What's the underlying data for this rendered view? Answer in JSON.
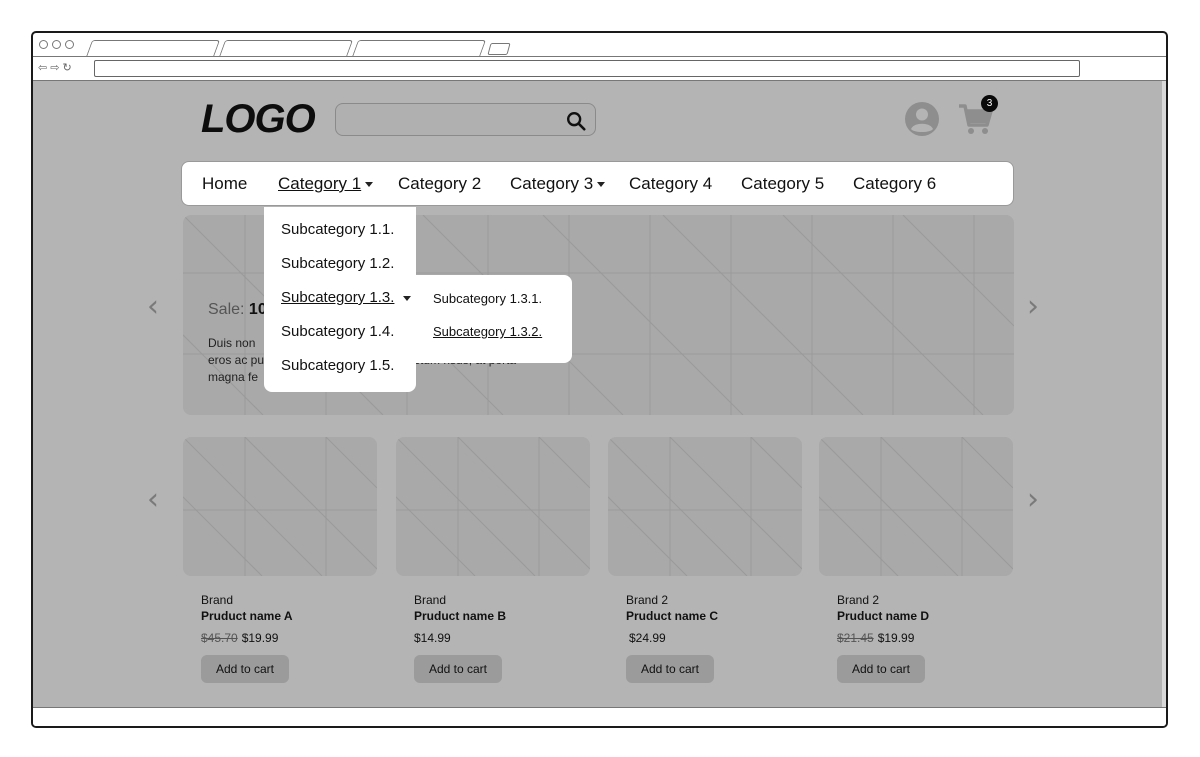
{
  "header": {
    "logo": "LOGO",
    "search_placeholder": "",
    "cart_count": "3"
  },
  "nav": {
    "items": [
      {
        "label": "Home",
        "has_caret": false,
        "active": false
      },
      {
        "label": "Category 1",
        "has_caret": true,
        "active": true
      },
      {
        "label": "Category 2",
        "has_caret": false,
        "active": false
      },
      {
        "label": "Category 3",
        "has_caret": true,
        "active": false
      },
      {
        "label": "Category 4",
        "has_caret": false,
        "active": false
      },
      {
        "label": "Category 5",
        "has_caret": false,
        "active": false
      },
      {
        "label": "Category 6",
        "has_caret": false,
        "active": false
      }
    ]
  },
  "dropdown": {
    "items": [
      {
        "label": "Subcategory 1.1."
      },
      {
        "label": "Subcategory 1.2."
      },
      {
        "label": "Subcategory 1.3.",
        "active": true,
        "has_caret": true
      },
      {
        "label": "Subcategory 1.4."
      },
      {
        "label": "Subcategory 1.5."
      }
    ],
    "submenu": [
      {
        "label": "Subcategory 1.3.1."
      },
      {
        "label": "Subcategory 1.3.2.",
        "active": true
      }
    ]
  },
  "hero": {
    "title_prefix": "Sale:",
    "title_rest": "10",
    "text_line1": "Duis non",
    "text_line2": "eros ac pu",
    "text_line2_tail": "ctum risus, at porta",
    "text_line3": "magna fe"
  },
  "products": [
    {
      "brand": "Brand",
      "name": "Pruduct name A",
      "old_price": "$45.70",
      "price": "$19.99",
      "button": "Add to cart"
    },
    {
      "brand": "Brand",
      "name": "Pruduct name B",
      "old_price": "",
      "price": "$14.99",
      "button": "Add to cart"
    },
    {
      "brand": "Brand 2",
      "name": "Pruduct name C",
      "old_price": "",
      "price": "$24.99",
      "button": "Add to cart"
    },
    {
      "brand": "Brand 2",
      "name": "Pruduct name D",
      "old_price": "$21.45",
      "price": "$19.99",
      "button": "Add to cart"
    }
  ],
  "colors": {
    "page_bg": "#b4b4b4",
    "placeholder_bg": "#a9a9a9",
    "button_bg": "#9b9b9b"
  }
}
